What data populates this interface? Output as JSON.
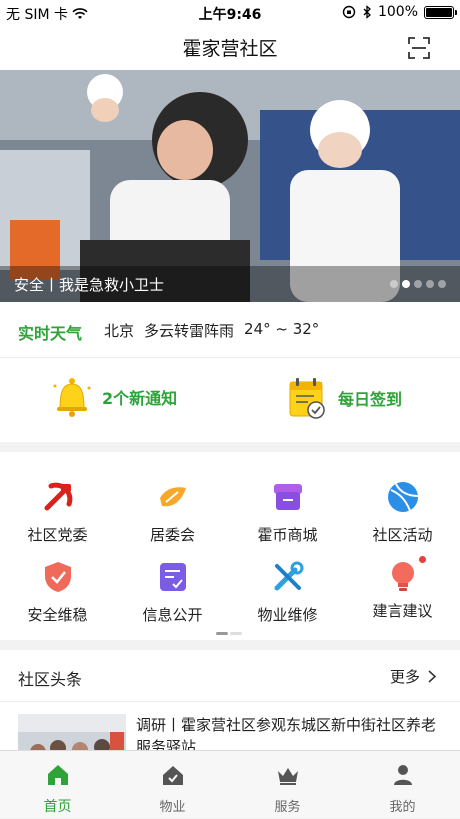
{
  "status_bar": {
    "carrier": "无 SIM 卡",
    "time": "上午9:46",
    "battery": "100%"
  },
  "header": {
    "title": "霍家营社区"
  },
  "banner": {
    "caption": "安全丨我是急救小卫士",
    "dot_count": 5,
    "active_dot": 1
  },
  "weather": {
    "label": "实时天气",
    "city": "北京",
    "condition": "多云转雷阵雨",
    "temperature": "24° ~ 32°"
  },
  "quick": {
    "notice_label": "2个新通知",
    "signin_label": "每日签到"
  },
  "grid": {
    "items": [
      {
        "label": "社区党委",
        "icon": "party-emblem-icon"
      },
      {
        "label": "居委会",
        "icon": "committee-icon"
      },
      {
        "label": "霍币商城",
        "icon": "mall-icon"
      },
      {
        "label": "社区活动",
        "icon": "activity-ball-icon"
      },
      {
        "label": "安全维稳",
        "icon": "shield-check-icon"
      },
      {
        "label": "信息公开",
        "icon": "info-doc-icon"
      },
      {
        "label": "物业维修",
        "icon": "repair-tools-icon"
      },
      {
        "label": "建言建议",
        "icon": "lightbulb-icon"
      }
    ]
  },
  "news": {
    "section_title": "社区头条",
    "more_label": "更多",
    "items": [
      {
        "title": "调研丨霍家营社区参观东城区新中街社区养老服务驿站"
      }
    ]
  },
  "tabbar": {
    "tabs": [
      {
        "label": "首页",
        "icon": "home-icon",
        "active": true
      },
      {
        "label": "物业",
        "icon": "property-house-icon",
        "active": false
      },
      {
        "label": "服务",
        "icon": "crown-service-icon",
        "active": false
      },
      {
        "label": "我的",
        "icon": "user-icon",
        "active": false
      }
    ]
  },
  "colors": {
    "accent": "#2fa23a",
    "alert": "#e54040"
  }
}
